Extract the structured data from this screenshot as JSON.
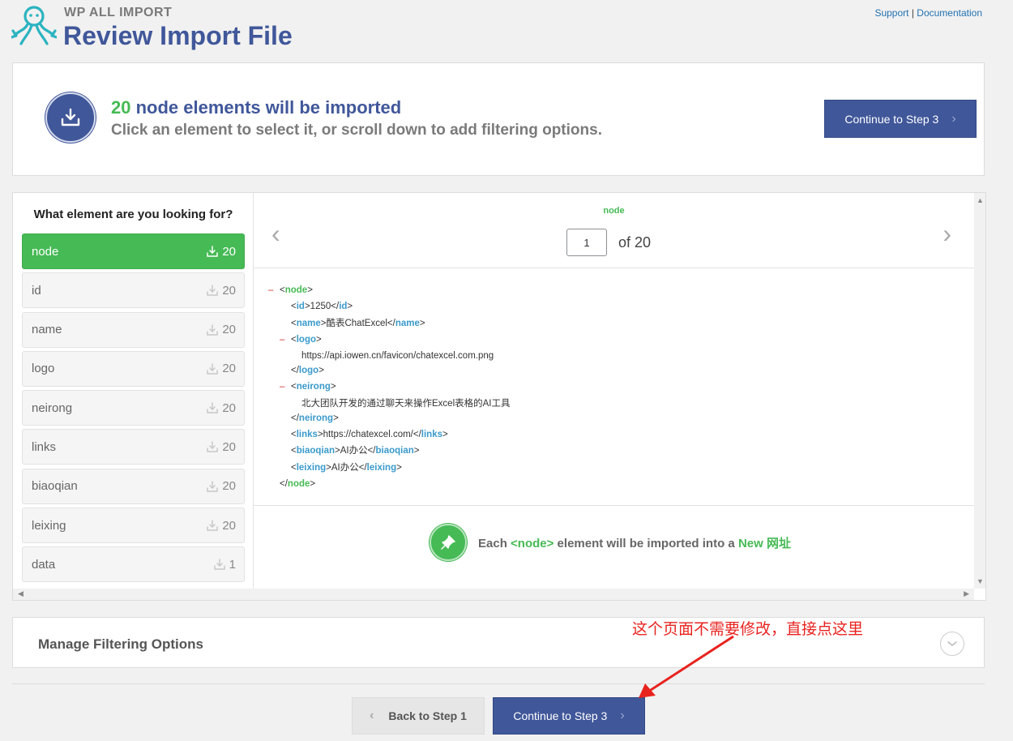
{
  "header": {
    "brand_small": "WP ALL IMPORT",
    "title": "Review Import File",
    "link_support": "Support",
    "link_sep": "|",
    "link_documentation": "Documentation"
  },
  "summary": {
    "count": "20",
    "headline_rest": " node elements will be imported",
    "subline": "Click an element to select it, or scroll down to add filtering options.",
    "continue_label": "Continue to Step 3"
  },
  "elements": {
    "heading": "What element are you looking for?",
    "items": [
      {
        "label": "node",
        "count": "20",
        "active": true
      },
      {
        "label": "id",
        "count": "20"
      },
      {
        "label": "name",
        "count": "20"
      },
      {
        "label": "logo",
        "count": "20"
      },
      {
        "label": "neirong",
        "count": "20"
      },
      {
        "label": "links",
        "count": "20"
      },
      {
        "label": "biaoqian",
        "count": "20"
      },
      {
        "label": "leixing",
        "count": "20"
      },
      {
        "label": "data",
        "count": "1"
      }
    ]
  },
  "preview": {
    "node_label": "node",
    "page_value": "1",
    "page_of": "of 20",
    "xml": {
      "id": "1250",
      "name": "酷表ChatExcel",
      "logo": "https://api.iowen.cn/favicon/chatexcel.com.png",
      "neirong": "北大团队开发的通过聊天来操作Excel表格的AI工具",
      "links": "https://chatexcel.com/",
      "biaoqian": "AI办公",
      "leixing": "AI办公"
    },
    "import_prefix": "Each ",
    "import_tag": "<node>",
    "import_mid": " element will be imported into a ",
    "import_target": "New 网址"
  },
  "filter": {
    "title": "Manage Filtering Options"
  },
  "footer": {
    "back_label": "Back to Step 1",
    "continue_label": "Continue to Step 3"
  },
  "annotation": {
    "text": "这个页面不需要修改，直接点这里",
    "color": "#e8231f"
  },
  "colors": {
    "primary": "#40579a",
    "green": "#46ba55"
  }
}
